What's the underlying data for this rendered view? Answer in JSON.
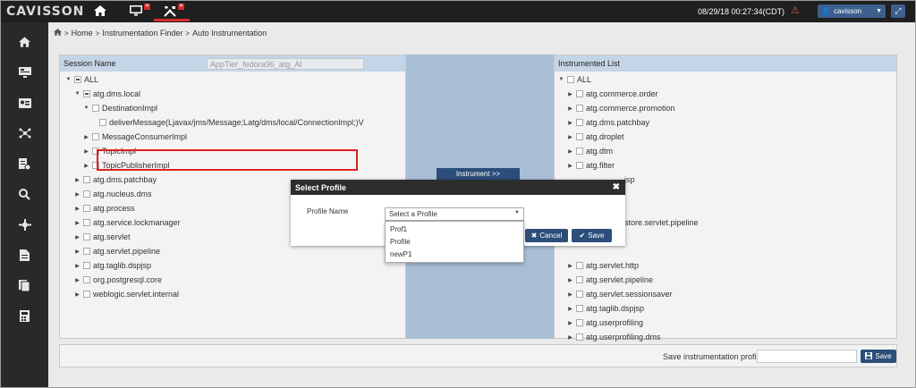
{
  "brand": "CAVISSON",
  "topbar": {
    "home_icon": "home-icon",
    "monitor_icon": "monitor-icon",
    "tools_icon": "tools-icon",
    "datetime": "08/29/18 00:27:34(CDT)",
    "user": "cavisson",
    "accent": "#d52b2b"
  },
  "breadcrumb": [
    "Home",
    "Instrumentation Finder",
    "Auto Instrumentation"
  ],
  "left_panel": {
    "title": "Session Name",
    "session_value": "AppTier_fedora96_atg_AI",
    "nodes": [
      {
        "label": "ALL",
        "toggle": "▼",
        "cb": "partial"
      },
      {
        "label": "atg.dms.local",
        "toggle": "▼",
        "cb": "partial"
      },
      {
        "label": "DestinationImpl",
        "toggle": "▼",
        "cb": ""
      },
      {
        "label": "deliverMessage(Ljavax/jms/Message;Latg/dms/local/ConnectionImpl;)V",
        "toggle": "",
        "cb": ""
      },
      {
        "label": "MessageConsumerImpl",
        "toggle": "▶",
        "cb": ""
      },
      {
        "label": "TopicImpl",
        "toggle": "▶",
        "cb": ""
      },
      {
        "label": "TopicPublisherImpl",
        "toggle": "▶",
        "cb": ""
      },
      {
        "label": "atg.dms.patchbay",
        "toggle": "▶",
        "cb": ""
      },
      {
        "label": "atg.nucleus.dms",
        "toggle": "▶",
        "cb": ""
      },
      {
        "label": "atg.process",
        "toggle": "▶",
        "cb": ""
      },
      {
        "label": "atg.service.lockmanager",
        "toggle": "▶",
        "cb": ""
      },
      {
        "label": "atg.servlet",
        "toggle": "▶",
        "cb": ""
      },
      {
        "label": "atg.servlet.pipeline",
        "toggle": "▶",
        "cb": ""
      },
      {
        "label": "atg.taglib.dspjsp",
        "toggle": "▶",
        "cb": ""
      },
      {
        "label": "org.postgresql.core",
        "toggle": "▶",
        "cb": ""
      },
      {
        "label": "weblogic.servlet.internal",
        "toggle": "▶",
        "cb": ""
      }
    ]
  },
  "middle": {
    "instrument_label": "Instrument >>"
  },
  "right_panel": {
    "title": "Instrumented List",
    "nodes": [
      {
        "label": "ALL",
        "toggle": "▼"
      },
      {
        "label": "atg.commerce.order",
        "toggle": "▶"
      },
      {
        "label": "atg.commerce.promotion",
        "toggle": "▶"
      },
      {
        "label": "atg.dms.patchbay",
        "toggle": "▶"
      },
      {
        "label": "atg.droplet",
        "toggle": "▶"
      },
      {
        "label": "atg.dtm",
        "toggle": "▶"
      },
      {
        "label": "atg.filter",
        "toggle": "▶"
      },
      {
        "label": "jsp",
        "toggle": ""
      },
      {
        "label": "",
        "toggle": ""
      },
      {
        "label": "store.servlet.pipeline",
        "toggle": ""
      },
      {
        "label": "",
        "toggle": ""
      },
      {
        "label": "atg.servlet.http",
        "toggle": "▶"
      },
      {
        "label": "atg.servlet.pipeline",
        "toggle": "▶"
      },
      {
        "label": "atg.servlet.sessionsaver",
        "toggle": "▶"
      },
      {
        "label": "atg.taglib.dspjsp",
        "toggle": "▶"
      },
      {
        "label": "atg.userprofiling",
        "toggle": "▶"
      },
      {
        "label": "atg.userprofiling.dms",
        "toggle": "▶"
      }
    ]
  },
  "bottom": {
    "save_profile_label": "Save instrumentation profile as",
    "save_label": "Save"
  },
  "modal": {
    "title": "Select Profile",
    "profile_label": "Profile Name",
    "select_value": "Select a Profile",
    "options": [
      "Prof1",
      "Profile",
      "newP1"
    ],
    "cancel_label": "Cancel",
    "save_label": "Save"
  }
}
